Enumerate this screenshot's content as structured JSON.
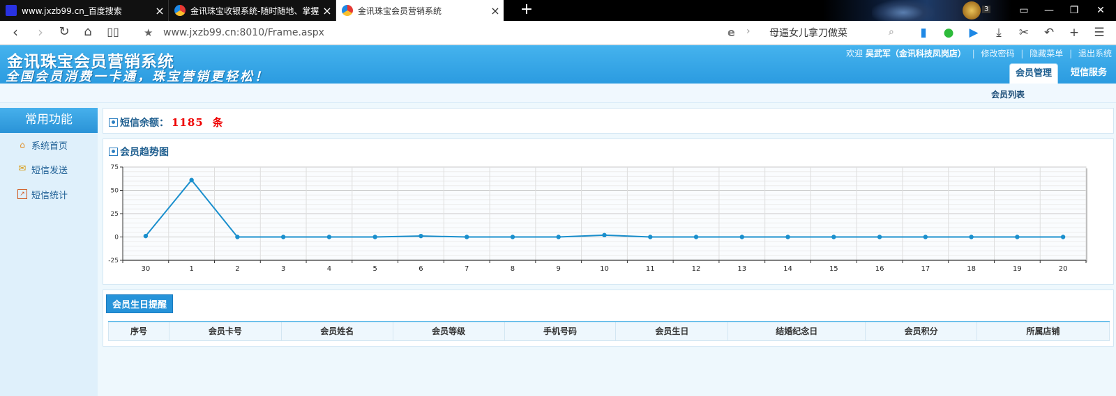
{
  "browser": {
    "tabs": [
      {
        "title": "www.jxzb99.cn_百度搜索",
        "active": false
      },
      {
        "title": "金讯珠宝收银系统-随时随地、掌握全局",
        "active": false
      },
      {
        "title": "金讯珠宝会员营销系统",
        "active": true
      }
    ],
    "new_tab": "+",
    "skin_badge": "3",
    "url": "www.jxzb99.cn:8010/Frame.aspx",
    "search_value": "母逼女儿拿刀做菜",
    "window_buttons": [
      "▭",
      "—",
      "❐",
      "✕"
    ]
  },
  "app": {
    "title": "金讯珠宝会员营销系统",
    "slogan": "全国会员消费一卡通，珠宝营销更轻松！",
    "user": {
      "welcome": "欢迎",
      "name": "吴武军（金讯科技凤岗店）",
      "change_password": "修改密码",
      "hide_menu": "隐藏菜单",
      "logout": "退出系统"
    },
    "main_tabs": [
      {
        "label": "会员管理",
        "active": true
      },
      {
        "label": "短信服务",
        "active": false
      }
    ],
    "sub_nav": "会员列表"
  },
  "sidebar": {
    "title": "常用功能",
    "items": [
      {
        "label": "系统首页",
        "icon": "home-icon"
      },
      {
        "label": "短信发送",
        "icon": "mail-icon"
      },
      {
        "label": "短信统计",
        "icon": "chart-icon"
      }
    ]
  },
  "sms": {
    "label": "短信余额：",
    "value": "1185",
    "unit": "条"
  },
  "trend": {
    "title": "会员趋势图"
  },
  "chart_data": {
    "type": "line",
    "categories": [
      "30",
      "1",
      "2",
      "3",
      "4",
      "5",
      "6",
      "7",
      "8",
      "9",
      "10",
      "11",
      "12",
      "13",
      "14",
      "15",
      "16",
      "17",
      "18",
      "19",
      "20"
    ],
    "values": [
      1,
      61,
      0,
      0,
      0,
      0,
      1,
      0,
      0,
      0,
      2,
      0,
      0,
      0,
      0,
      0,
      0,
      0,
      0,
      0,
      0
    ],
    "ylim": [
      -25,
      75
    ],
    "yticks": [
      -25,
      0,
      25,
      50,
      75
    ],
    "grid": true,
    "color": "#1a8fcd"
  },
  "birthday": {
    "button": "会员生日提醒",
    "columns": [
      "序号",
      "会员卡号",
      "会员姓名",
      "会员等级",
      "手机号码",
      "会员生日",
      "结婚纪念日",
      "会员积分",
      "所属店铺"
    ]
  }
}
